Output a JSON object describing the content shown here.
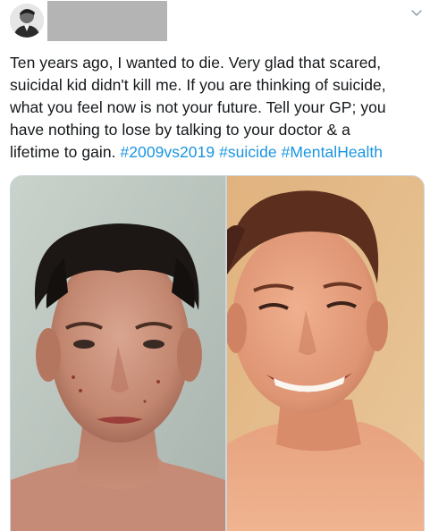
{
  "tweet": {
    "author_name_redacted": true,
    "text_lines": [
      "Ten years ago, I wanted to die. Very glad that scared,",
      "suicidal kid didn't kill me. If you are thinking of suicide,",
      "what you feel now is not your future. Tell your GP; you",
      "have nothing to lose by talking to your doctor & a",
      "lifetime to gain."
    ],
    "hashtags": [
      "#2009vs2019",
      "#suicide",
      "#MentalHealth"
    ],
    "media": {
      "left_photo": "photo-2009",
      "right_photo": "photo-2019"
    }
  },
  "colors": {
    "text": "#14171a",
    "hashtag": "#1b95e0",
    "border": "#ccd6dd",
    "redaction": "#b4b4b4"
  },
  "icons": {
    "menu": "chevron-down-icon"
  }
}
